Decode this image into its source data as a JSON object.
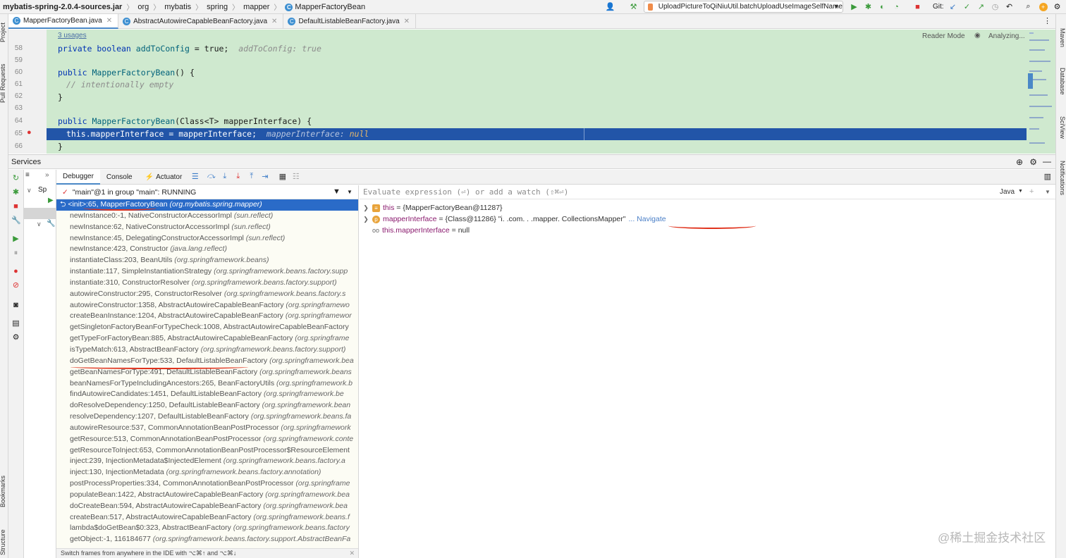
{
  "navbar": {
    "crumbs": [
      "mybatis-spring-2.0.4-sources.jar",
      "org",
      "mybatis",
      "spring",
      "mapper",
      "MapperFactoryBean"
    ],
    "run_config": "UploadPictureToQiNiuUtil.batchUploadUseImageSelfName",
    "git_label": "Git:"
  },
  "tabs": [
    {
      "label": "MapperFactoryBean.java",
      "active": true
    },
    {
      "label": "AbstractAutowireCapableBeanFactory.java",
      "active": false
    },
    {
      "label": "DefaultListableBeanFactory.java",
      "active": false
    }
  ],
  "side_labels": {
    "left": [
      "Project",
      "Pull Requests",
      "Bookmarks",
      "Structure"
    ],
    "right": [
      "Maven",
      "Database",
      "SciView",
      "Notifications"
    ]
  },
  "editor": {
    "usages": "3 usages",
    "reader_mode": "Reader Mode",
    "analyzing": "Analyzing...",
    "lines": [
      {
        "num": "58",
        "text_kw": "private boolean ",
        "text_fn": "addToConfig",
        "text_rest": " = true;",
        "hint": "addToConfig: true"
      },
      {
        "num": "59"
      },
      {
        "num": "60",
        "text_kw": "public ",
        "text_fn": "MapperFactoryBean",
        "text_rest": "() {"
      },
      {
        "num": "61",
        "comment": "// intentionally empty"
      },
      {
        "num": "62",
        "text_rest": "}"
      },
      {
        "num": "63"
      },
      {
        "num": "64",
        "text_kw": "public ",
        "text_fn": "MapperFactoryBean",
        "text_rest": "(Class<T> mapperInterface) {"
      },
      {
        "num": "65",
        "exec_code": "this.mapperInterface = mapperInterface;",
        "hint_name": "mapperInterface:",
        "hint_val": "null"
      },
      {
        "num": "66",
        "text_rest": "}"
      }
    ]
  },
  "services": {
    "title": "Services",
    "tree_item": "Sp"
  },
  "debugger": {
    "tabs": [
      "Debugger",
      "Console",
      "Actuator"
    ],
    "thread": "\"main\"@1 in group \"main\": RUNNING",
    "frames": [
      {
        "m": "<init>:65, MapperFactoryBean",
        "p": "(org.mybatis.spring.mapper)",
        "sel": true
      },
      {
        "m": "newInstance0:-1, NativeConstructorAccessorImpl",
        "p": "(sun.reflect)"
      },
      {
        "m": "newInstance:62, NativeConstructorAccessorImpl",
        "p": "(sun.reflect)"
      },
      {
        "m": "newInstance:45, DelegatingConstructorAccessorImpl",
        "p": "(sun.reflect)"
      },
      {
        "m": "newInstance:423, Constructor",
        "p": "(java.lang.reflect)"
      },
      {
        "m": "instantiateClass:203, BeanUtils",
        "p": "(org.springframework.beans)"
      },
      {
        "m": "instantiate:117, SimpleInstantiationStrategy",
        "p": "(org.springframework.beans.factory.supp"
      },
      {
        "m": "instantiate:310, ConstructorResolver",
        "p": "(org.springframework.beans.factory.support)"
      },
      {
        "m": "autowireConstructor:295, ConstructorResolver",
        "p": "(org.springframework.beans.factory.s"
      },
      {
        "m": "autowireConstructor:1358, AbstractAutowireCapableBeanFactory",
        "p": "(org.springframewo"
      },
      {
        "m": "createBeanInstance:1204, AbstractAutowireCapableBeanFactory",
        "p": "(org.springframewor"
      },
      {
        "m": "getSingletonFactoryBeanForTypeCheck:1008, AbstractAutowireCapableBeanFactory",
        "p": ""
      },
      {
        "m": "getTypeForFactoryBean:885, AbstractAutowireCapableBeanFactory",
        "p": "(org.springframe"
      },
      {
        "m": "isTypeMatch:613, AbstractBeanFactory",
        "p": "(org.springframework.beans.factory.support)"
      },
      {
        "m": "doGetBeanNamesForType:533, DefaultListableBeanFactory",
        "p": "(org.springframework.bea"
      },
      {
        "m": "getBeanNamesForType:491, DefaultListableBeanFactory",
        "p": "(org.springframework.beans"
      },
      {
        "m": "beanNamesForTypeIncludingAncestors:265, BeanFactoryUtils",
        "p": "(org.springframework.b"
      },
      {
        "m": "findAutowireCandidates:1451, DefaultListableBeanFactory",
        "p": "(org.springframework.be"
      },
      {
        "m": "doResolveDependency:1250, DefaultListableBeanFactory",
        "p": "(org.springframework.bean"
      },
      {
        "m": "resolveDependency:1207, DefaultListableBeanFactory",
        "p": "(org.springframework.beans.fa"
      },
      {
        "m": "autowireResource:537, CommonAnnotationBeanPostProcessor",
        "p": "(org.springframework"
      },
      {
        "m": "getResource:513, CommonAnnotationBeanPostProcessor",
        "p": "(org.springframework.conte"
      },
      {
        "m": "getResourceToInject:653, CommonAnnotationBeanPostProcessor$ResourceElement",
        "p": ""
      },
      {
        "m": "inject:239, InjectionMetadata$InjectedElement",
        "p": "(org.springframework.beans.factory.a"
      },
      {
        "m": "inject:130, InjectionMetadata",
        "p": "(org.springframework.beans.factory.annotation)"
      },
      {
        "m": "postProcessProperties:334, CommonAnnotationBeanPostProcessor",
        "p": "(org.springframe"
      },
      {
        "m": "populateBean:1422, AbstractAutowireCapableBeanFactory",
        "p": "(org.springframework.bea"
      },
      {
        "m": "doCreateBean:594, AbstractAutowireCapableBeanFactory",
        "p": "(org.springframework.bea"
      },
      {
        "m": "createBean:517, AbstractAutowireCapableBeanFactory",
        "p": "(org.springframework.beans.f"
      },
      {
        "m": "lambda$doGetBean$0:323, AbstractBeanFactory",
        "p": "(org.springframework.beans.factory"
      },
      {
        "m": "getObject:-1, 116184677",
        "p": "(org.springframework.beans.factory.support.AbstractBeanFa"
      }
    ],
    "frames_hint": "Switch frames from anywhere in the IDE with ⌥⌘↑ and ⌥⌘↓",
    "eval_placeholder": "Evaluate expression (⏎) or add a watch (⇧⌘⏎)",
    "lang": "Java",
    "variables": [
      {
        "name": "this",
        "value": "= {MapperFactoryBean@11287}",
        "icon_color": "#e8a33a",
        "icon": "≡"
      },
      {
        "name": "mapperInterface",
        "value": "= {Class@11286} \"i.      .com.           .   .mapper.     CollectionsMapper\"",
        "icon_color": "#e8a33a",
        "icon": "p",
        "nav": "... Navigate"
      },
      {
        "name": "this.mapperInterface",
        "value": "= null",
        "icon_color": "#888888",
        "icon": "oo"
      }
    ]
  },
  "watermark": "@稀土掘金技术社区"
}
